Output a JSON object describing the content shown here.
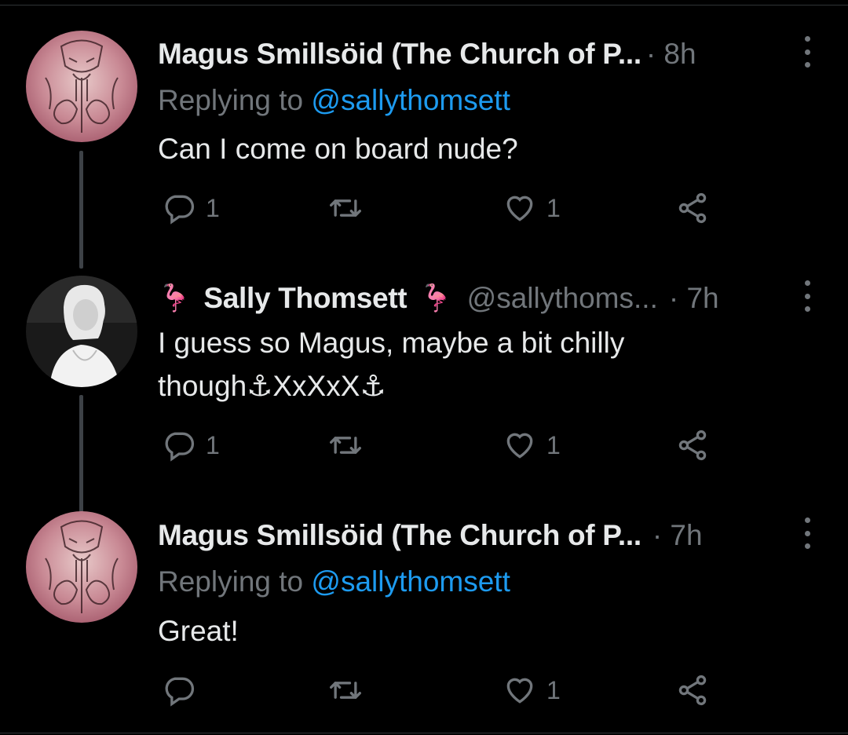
{
  "tweets": [
    {
      "author": "Magus Smillsöid (The Church of P...",
      "time": "· 8h",
      "replying_label": "Replying to",
      "mention": "@sallythomsett",
      "text": "Can I come on board nude?",
      "reply_count": "1",
      "retweet_count": "",
      "like_count": "1"
    },
    {
      "author": "Sally Thomsett",
      "name_emoji_left": "🦩",
      "name_emoji_right": "🦩",
      "handle": "@sallythoms...",
      "time": "· 7h",
      "text": "I guess so Magus, maybe a bit chilly\nthough⚓XxXxX⚓",
      "reply_count": "1",
      "retweet_count": "",
      "like_count": "1"
    },
    {
      "author": "Magus Smillsöid (The Church of P...",
      "time": "· 7h",
      "replying_label": "Replying to",
      "mention": "@sallythomsett",
      "text": "Great!",
      "reply_count": "",
      "retweet_count": "",
      "like_count": "1"
    }
  ],
  "icons": {
    "reply": "reply-icon",
    "retweet": "retweet-icon",
    "like": "heart-icon",
    "share": "share-icon",
    "more": "more-options-icon"
  },
  "colors": {
    "background": "#000000",
    "text": "#e7e9ea",
    "secondary": "#71767b",
    "link": "#1d9bf0",
    "thread_line": "#3d4146"
  }
}
